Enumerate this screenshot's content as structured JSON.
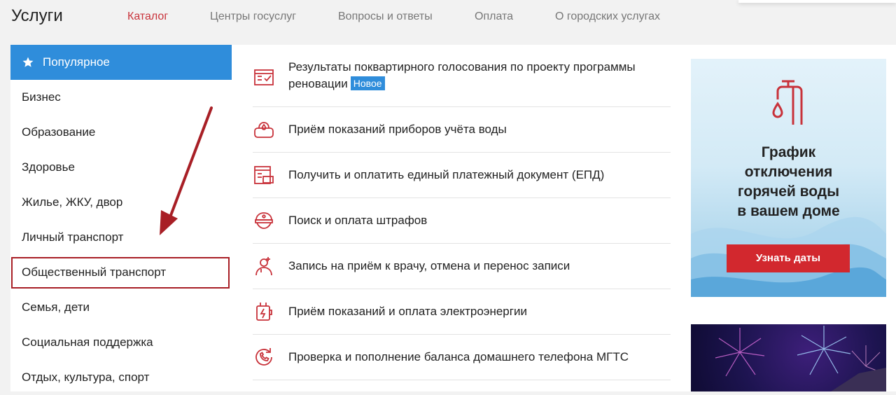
{
  "header": {
    "title": "Услуги",
    "nav": [
      "Каталог",
      "Центры госуслуг",
      "Вопросы и ответы",
      "Оплата",
      "О городских услугах"
    ]
  },
  "sidebar": {
    "items": [
      {
        "label": "Популярное",
        "active": true
      },
      {
        "label": "Бизнес"
      },
      {
        "label": "Образование"
      },
      {
        "label": "Здоровье"
      },
      {
        "label": "Жилье, ЖКУ, двор"
      },
      {
        "label": "Личный транспорт"
      },
      {
        "label": "Общественный транспорт",
        "highlighted": true
      },
      {
        "label": "Семья, дети"
      },
      {
        "label": "Социальная поддержка"
      },
      {
        "label": "Отдых, культура, спорт"
      }
    ]
  },
  "services": [
    {
      "line1": "Результаты поквартирного голосования по проекту программы",
      "line2": "реновации",
      "badge": "Новое",
      "icon": "ballot-icon"
    },
    {
      "text": "Приём показаний приборов учёта воды",
      "icon": "water-meter-icon"
    },
    {
      "text": "Получить и оплатить единый платежный документ (ЕПД)",
      "icon": "payment-document-icon"
    },
    {
      "text": "Поиск и оплата штрафов",
      "icon": "police-cap-icon"
    },
    {
      "text": "Запись на приём к врачу, отмена и перенос записи",
      "icon": "doctor-icon"
    },
    {
      "text": "Приём показаний и оплата электроэнергии",
      "icon": "electricity-icon"
    },
    {
      "text": "Проверка и пополнение баланса домашнего телефона МГТС",
      "icon": "phone-icon"
    }
  ],
  "banner": {
    "line1": "График",
    "line2": "отключения",
    "line3": "горячей воды",
    "line4": "в вашем доме",
    "button": "Узнать даты"
  },
  "colors": {
    "accent": "#2f8ddb",
    "brand_red": "#c8323a",
    "annotation": "#a81f26",
    "button_red": "#d2282e"
  }
}
